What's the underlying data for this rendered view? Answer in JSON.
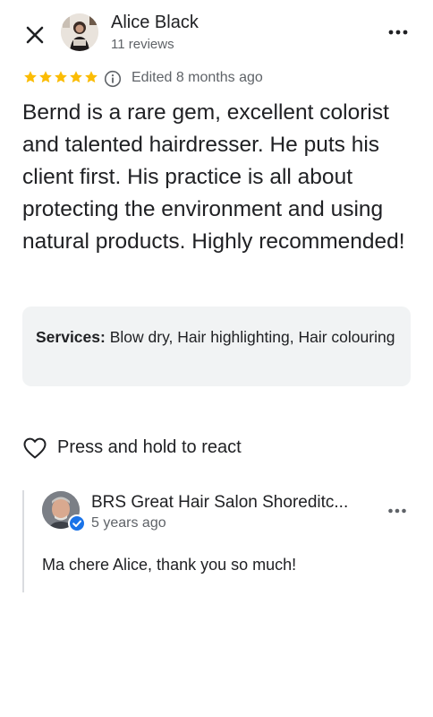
{
  "header": {
    "reviewer_name": "Alice Black",
    "review_count": "11 reviews"
  },
  "rating": {
    "stars": 5,
    "edited": "Edited 8 months ago"
  },
  "review": {
    "text": "Bernd is a rare gem, excellent colorist and talented hairdresser. He puts his client first. His practice is all about protecting the environment and using natural products. Highly recommended!"
  },
  "services": {
    "label": "Services:",
    "value": "Blow dry, Hair highlighting, Hair colouring"
  },
  "react": {
    "label": "Press and hold to react"
  },
  "owner_response": {
    "name": "BRS Great Hair Salon Shoreditc...",
    "time": "5 years ago",
    "text": "Ma chere Alice, thank you so much!"
  },
  "icons": {
    "close": "close-icon",
    "more": "more-options-icon",
    "star": "star-icon",
    "info": "info-icon",
    "heart": "heart-outline-icon",
    "verified": "verified-check-icon"
  },
  "colors": {
    "star": "#fbbc04",
    "secondary_text": "#5f6368",
    "services_bg": "#f1f3f4",
    "verified": "#1a73e8"
  }
}
